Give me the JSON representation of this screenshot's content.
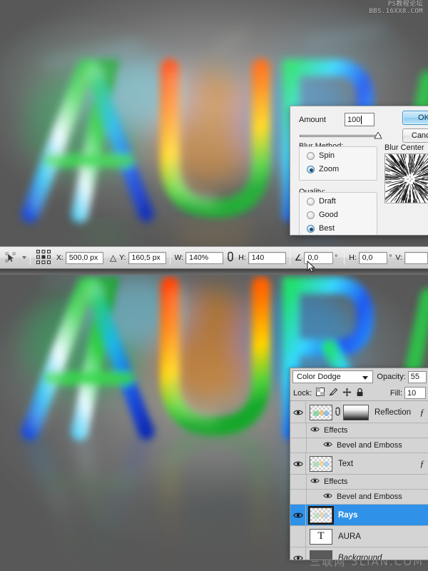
{
  "app": {
    "name": "Adobe Photoshop",
    "screenshot_kind": "photoshop-radial-blur-tutorial"
  },
  "watermarks": {
    "top_line1": "PS教程论坛",
    "top_line2": "BBS.16XX8.COM",
    "bottom": "三联网 3LIAN.COM"
  },
  "artwork": {
    "text": "AURA",
    "description": "Colorful rainbow aura text effect on grey gradient background with reflection"
  },
  "options_bar": {
    "tool_icon": "move-tool-icon",
    "reference_point_icon": "reference-point-grid-icon",
    "fields": [
      {
        "label": "X:",
        "value": "500,0 px",
        "name": "x-position-field",
        "size": "lg"
      },
      {
        "label": "Y:",
        "value": "160,5 px",
        "name": "y-position-field",
        "size": "lg"
      },
      {
        "label": "W:",
        "value": "140%",
        "name": "width-field",
        "size": "lg"
      },
      {
        "label": "H:",
        "value": "140",
        "name": "height-field",
        "size": "lg"
      },
      {
        "label": "",
        "value": "0,0",
        "name": "rotation-field",
        "size": "md",
        "unit": "°"
      },
      {
        "label": "H:",
        "value": "0,0",
        "name": "skew-h-field",
        "size": "md",
        "unit": "°"
      },
      {
        "label": "V:",
        "value": "",
        "name": "skew-v-field",
        "size": "sm",
        "unit": ""
      }
    ],
    "delta_symbol": "△",
    "angle_symbol": "∠",
    "link_icon": "chain-link-icon"
  },
  "radial_blur_dialog": {
    "amount_label": "Amount",
    "amount_value": "100",
    "ok_label": "OK",
    "cancel_label": "Cancel",
    "blur_method": {
      "heading": "Blur Method:",
      "options": [
        {
          "label": "Spin",
          "selected": false
        },
        {
          "label": "Zoom",
          "selected": true
        }
      ]
    },
    "quality": {
      "heading": "Quality:",
      "options": [
        {
          "label": "Draft",
          "selected": false
        },
        {
          "label": "Good",
          "selected": false
        },
        {
          "label": "Best",
          "selected": true
        }
      ]
    },
    "blur_center": {
      "label": "Blur Center",
      "preview_name": "blur-center-preview"
    }
  },
  "layers_panel": {
    "blend_mode": "Color Dodge",
    "opacity_label": "Opacity:",
    "opacity_value": "55",
    "lock_label": "Lock:",
    "lock_icons": [
      "lock-transparency-icon",
      "lock-image-pixels-icon",
      "lock-position-icon",
      "lock-all-icon"
    ],
    "fill_label": "Fill:",
    "fill_value": "10",
    "rows": [
      {
        "type": "layer",
        "name": "Reflection",
        "visible": true,
        "selected": false,
        "has_mask": true,
        "has_link": true,
        "has_fx": true,
        "thumb": "transparent-art"
      },
      {
        "type": "effects-group",
        "name": "Effects",
        "visible": true,
        "indent": 1
      },
      {
        "type": "effect",
        "name": "Bevel and Emboss",
        "visible": true,
        "indent": 2
      },
      {
        "type": "layer",
        "name": "Text",
        "visible": true,
        "selected": false,
        "has_mask": false,
        "has_link": false,
        "has_fx": true,
        "thumb": "transparent-art"
      },
      {
        "type": "effects-group",
        "name": "Effects",
        "visible": true,
        "indent": 1
      },
      {
        "type": "effect",
        "name": "Bevel and Emboss",
        "visible": true,
        "indent": 2
      },
      {
        "type": "layer",
        "name": "Rays",
        "visible": true,
        "selected": true,
        "has_mask": false,
        "has_link": false,
        "has_fx": false,
        "thumb": "transparent-art"
      },
      {
        "type": "layer",
        "name": "AURA",
        "visible": false,
        "selected": false,
        "has_mask": false,
        "has_link": false,
        "has_fx": false,
        "thumb": "text-T"
      },
      {
        "type": "layer",
        "name": "Background",
        "visible": true,
        "selected": false,
        "italic": true,
        "has_mask": false,
        "has_link": false,
        "has_fx": false,
        "thumb": "solid-dark"
      }
    ]
  },
  "colors": {
    "selection_blue": "#2f92e8",
    "panel_grey": "#d4d4d4",
    "dialog_grey": "#f0f0f0",
    "canvas_grey": "#6e6e6e",
    "ok_button_blue": "#8fcdf0"
  }
}
